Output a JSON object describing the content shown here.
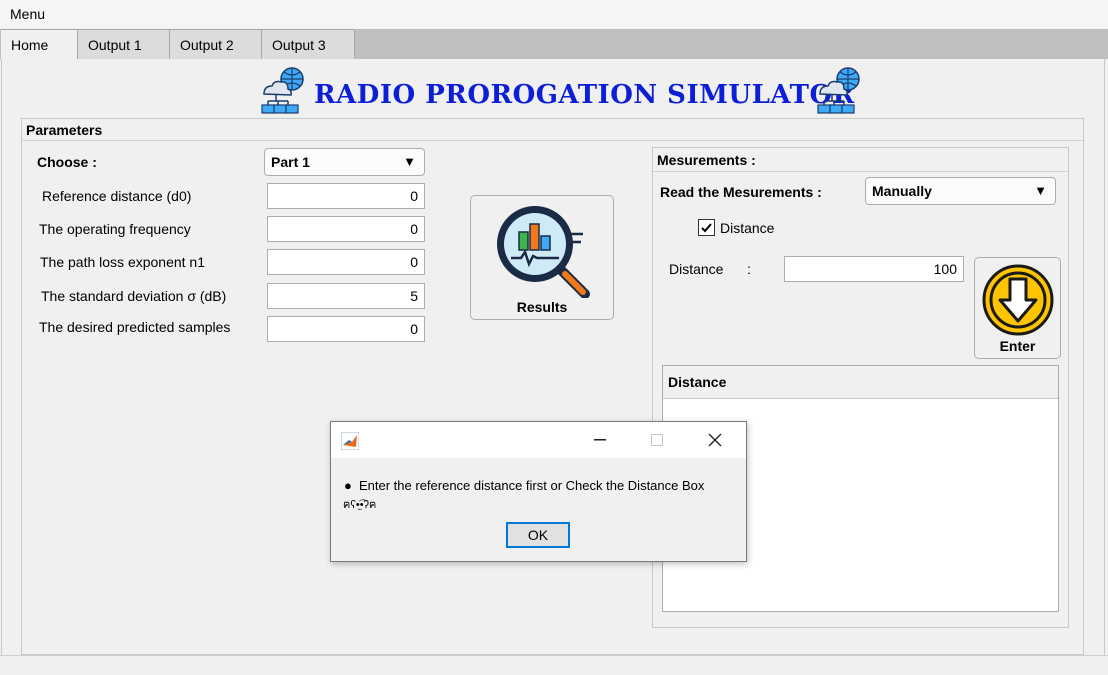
{
  "menu": {
    "label": "Menu"
  },
  "tabs": [
    {
      "label": "Home",
      "active": true
    },
    {
      "label": "Output 1",
      "active": false
    },
    {
      "label": "Output 2",
      "active": false
    },
    {
      "label": "Output 3",
      "active": false
    }
  ],
  "title": "RADIO PROROGATION SIMULATOR",
  "colors": {
    "title": "#0d1fd6",
    "accent_yellow": "#ffc400",
    "focus_blue": "#0078d7"
  },
  "parameters": {
    "title": "Parameters",
    "choose_label": "Choose :",
    "choose_value": "Part 1",
    "fields": [
      {
        "label": "Reference distance (d0)",
        "value": "0"
      },
      {
        "label": "The operating frequency",
        "value": "0"
      },
      {
        "label": "The path loss exponent n1",
        "value": "0"
      },
      {
        "label": "The standard deviation σ (dB)",
        "value": "5"
      },
      {
        "label": "The desired predicted samples",
        "value": "0"
      }
    ],
    "results_button": "Results"
  },
  "measurements": {
    "title": "Mesurements :",
    "read_label": "Read the Mesurements :",
    "read_value": "Manually",
    "checkbox_label": "Distance",
    "checkbox_checked": true,
    "distance_label": "Distance",
    "distance_colon": ":",
    "distance_value": "100",
    "enter_button": "Enter",
    "table_header": "Distance"
  },
  "dialog": {
    "message": "Enter the reference distance first or Check the Distance Box",
    "emoticon": "ฅʕ•̫͡•ʔฅ",
    "ok_label": "OK"
  },
  "icons": {
    "logo": "cloud-network-icon",
    "results": "magnifier-chart-icon",
    "enter": "arrow-down-circle-icon",
    "dialog": "matlab-icon"
  }
}
